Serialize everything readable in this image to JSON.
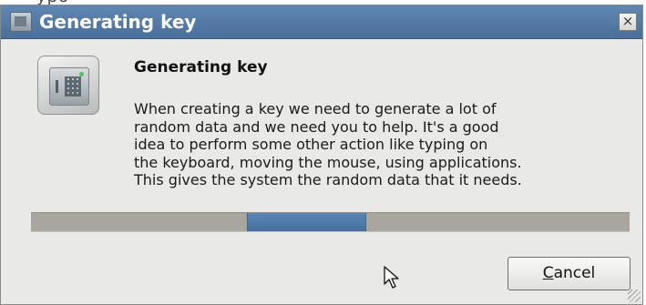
{
  "dialog": {
    "title": "Generating key",
    "heading": "Generating key",
    "message_lines": [
      "When creating a key we need to generate a lot of",
      "random data and we need you to help. It's a good",
      "idea to perform some other action like typing on",
      "the keyboard, moving the mouse, using applications.",
      "This gives the system the random data that it needs."
    ],
    "close_label": "×",
    "cancel_label_mnemonic": "C",
    "cancel_label_rest": "ancel",
    "icon": "safe-key-icon"
  },
  "progress": {
    "mode": "indeterminate",
    "chunk_start_fraction": 0.36,
    "chunk_end_fraction": 0.56
  },
  "colors": {
    "titlebar": "#4f76a1",
    "progress_track": "#a8a69f",
    "progress_chunk": "#4f7aa8",
    "dialog_bg": "#e9e9e7"
  }
}
